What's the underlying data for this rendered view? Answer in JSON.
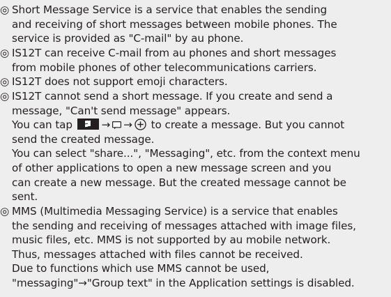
{
  "bullet_symbol": "◎",
  "notes": [
    {
      "lines": [
        "Short Message Service is a service that enables the sending",
        "and receiving of short messages between mobile phones. The",
        "service is provided as \"C-mail\" by au phone."
      ]
    },
    {
      "lines": [
        "IS12T can receive C-mail from au phones and short messages",
        "from mobile phones of other telecommunications carriers."
      ]
    },
    {
      "lines": [
        "IS12T does not support emoji characters."
      ]
    },
    {
      "lines": [
        "IS12T cannot send a short message. If you create and send a",
        "message, \"Can't send message\" appears."
      ],
      "icon_line": {
        "before": "You can tap",
        "arrow": "→",
        "after": "to create a message. But you cannot"
      },
      "more_lines": [
        "send the created message.",
        "You can select \"share...\", \"Messaging\", etc. from the context menu",
        "of other applications to open a new message screen and you",
        "can create a new message. But the created message cannot be",
        "sent."
      ]
    },
    {
      "lines": [
        "MMS (Multimedia Messaging Service) is a service that enables",
        "the sending and receiving of messages attached with image files,",
        "music files, etc. MMS is not supported by au mobile network.",
        "Thus, messages attached with files cannot be received.",
        "Due to functions which use MMS cannot be used,",
        "\"messaging\"→\"Group text\" in the Application settings is disabled."
      ]
    }
  ],
  "icons": {
    "start_key": "windows-start-key-icon",
    "messaging": "messaging-tile-icon",
    "new": "plus-circle-icon"
  },
  "colors": {
    "background": "#eeeeee",
    "text": "#231f20"
  }
}
